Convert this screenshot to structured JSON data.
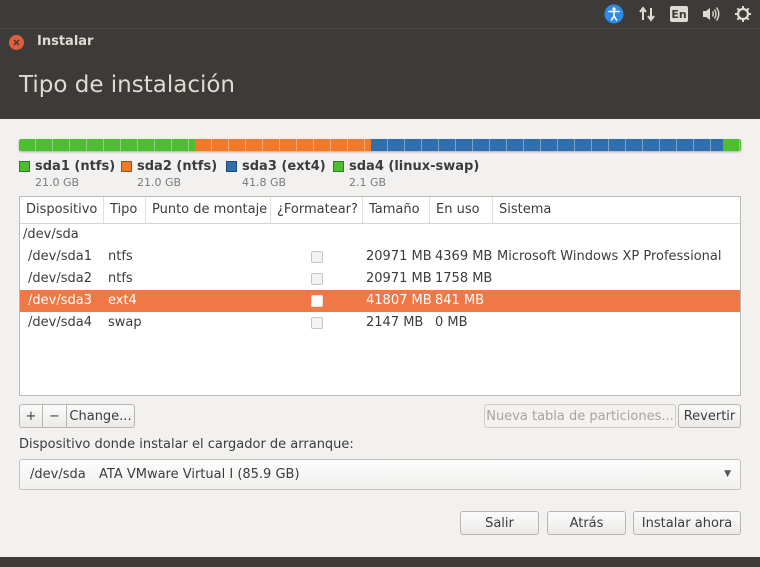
{
  "window": {
    "title": "Instalar"
  },
  "header": {
    "title": "Tipo de instalación"
  },
  "tray": {
    "accessibility_icon": "accessibility-icon",
    "network_icon": "network-updown-icon",
    "language": "En",
    "volume_icon": "volume-icon",
    "power_icon": "gear-power-icon"
  },
  "partitions": [
    {
      "name": "sda1 (ntfs)",
      "size": "21.0 GB",
      "color": "#4bbf30",
      "fraction": 0.244
    },
    {
      "name": "sda2 (ntfs)",
      "size": "21.0 GB",
      "color": "#f07a28",
      "fraction": 0.244
    },
    {
      "name": "sda3 (ext4)",
      "size": "41.8 GB",
      "color": "#2f6fad",
      "fraction": 0.487
    },
    {
      "name": "sda4 (linux-swap)",
      "size": "2.1 GB",
      "color": "#4bbf30",
      "fraction": 0.025
    }
  ],
  "table": {
    "headers": [
      "Dispositivo",
      "Tipo",
      "Punto de montaje",
      "¿Formatear?",
      "Tamaño",
      "En uso",
      "Sistema"
    ],
    "device": "/dev/sda",
    "rows": [
      {
        "device": "/dev/sda1",
        "type": "ntfs",
        "mount": "",
        "size": "20971 MB",
        "used": "4369 MB",
        "system": "Microsoft Windows XP Professional",
        "selected": false
      },
      {
        "device": "/dev/sda2",
        "type": "ntfs",
        "mount": "",
        "size": "20971 MB",
        "used": "1758 MB",
        "system": "",
        "selected": false
      },
      {
        "device": "/dev/sda3",
        "type": "ext4",
        "mount": "",
        "size": "41807 MB",
        "used": "841 MB",
        "system": "",
        "selected": true
      },
      {
        "device": "/dev/sda4",
        "type": "swap",
        "mount": "",
        "size": "2147 MB",
        "used": "0 MB",
        "system": "",
        "selected": false
      }
    ]
  },
  "toolbar": {
    "add_label": "+",
    "remove_label": "−",
    "change_label": "Change...",
    "new_table_label": "Nueva tabla de particiones...",
    "revert_label": "Revertir"
  },
  "bootloader": {
    "label": "Dispositivo donde instalar el cargador de arranque:",
    "device": "/dev/sda",
    "description": "ATA VMware Virtual I (85.9 GB)"
  },
  "actions": {
    "quit_label": "Salir",
    "back_label": "Atrás",
    "install_label": "Instalar ahora"
  },
  "colors": {
    "accent": "#f07746",
    "panel": "#3c3b37",
    "background": "#f2f1f0"
  }
}
